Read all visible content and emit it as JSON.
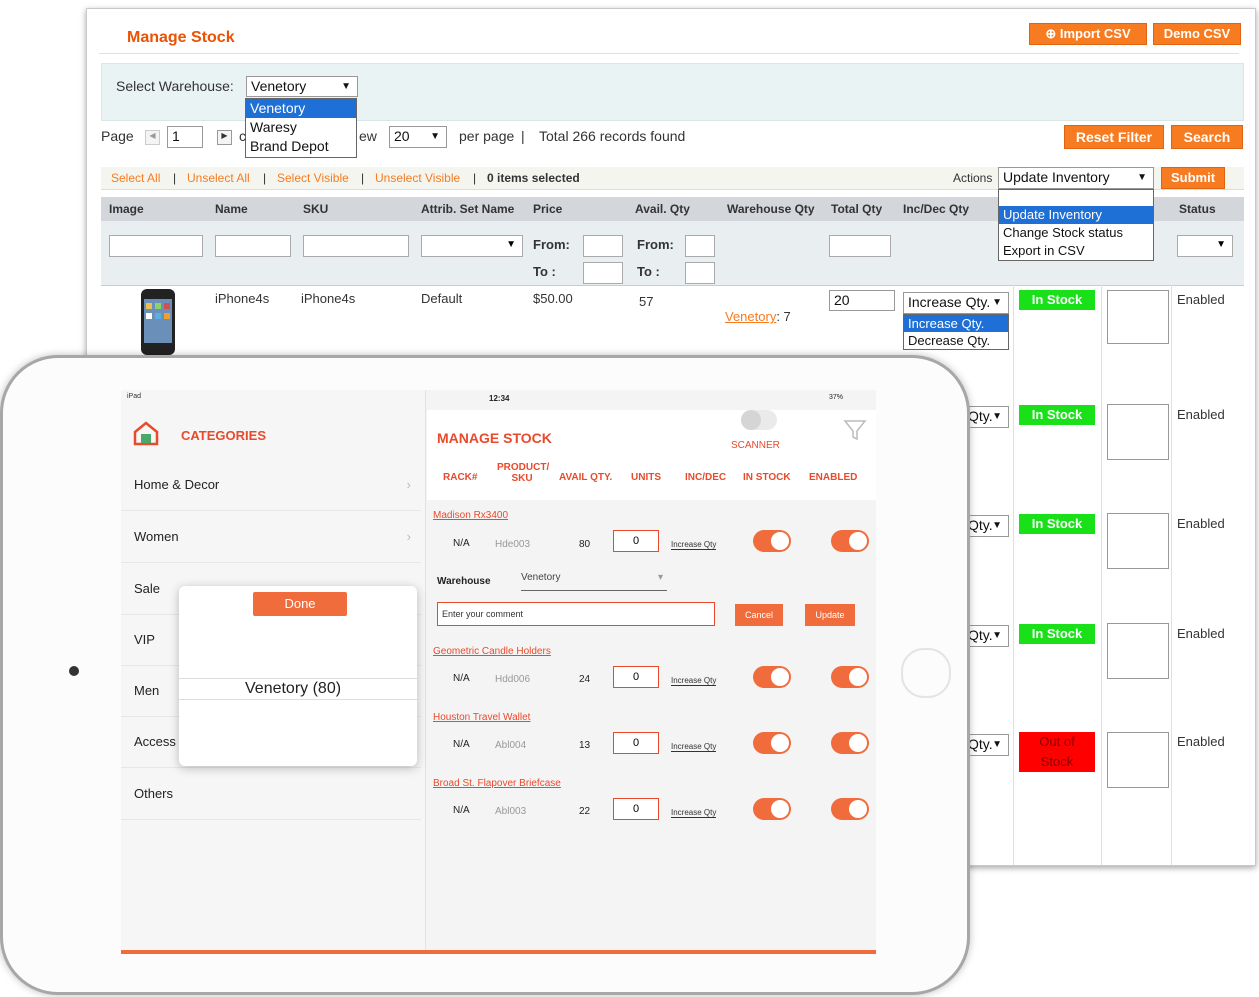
{
  "admin": {
    "title": "Manage Stock",
    "import_csv": "Import CSV",
    "demo_csv": "Demo CSV",
    "warehouse_label": "Select Warehouse:",
    "warehouse_value": "Venetory",
    "warehouse_options": [
      "Venetory",
      "Waresy",
      "Brand Depot"
    ],
    "page_label": "Page",
    "page_value": "1",
    "view_label_fragment": "ew",
    "per_page_value": "20",
    "per_page_label": "per page",
    "records_text": "Total 266 records found",
    "reset_filter": "Reset Filter",
    "search": "Search",
    "select_all": "Select All",
    "unselect_all": "Unselect All",
    "select_visible": "Select Visible",
    "unselect_visible": "Unselect Visible",
    "items_selected": "0 items selected",
    "actions_label": "Actions",
    "actions_value": "Update Inventory",
    "actions_options": [
      "Update Inventory",
      "Change Stock status",
      "Export in CSV"
    ],
    "submit": "Submit",
    "columns": [
      "Image",
      "Name",
      "SKU",
      "Attrib. Set Name",
      "Price",
      "Avail. Qty",
      "Warehouse Qty",
      "Total Qty",
      "Inc/Dec Qty",
      "Status"
    ],
    "from_label": "From:",
    "to_label": "To :",
    "row": {
      "name": "iPhone4s",
      "sku": "iPhone4s",
      "attrib": "Default",
      "price": "$50.00",
      "avail": "57",
      "warehouse_link": "Venetory",
      "warehouse_qty": ": 7",
      "total_qty": "20",
      "incdec_value": "Increase Qty.",
      "incdec_options": [
        "Increase Qty.",
        "Decrease Qty."
      ],
      "stock": "In Stock",
      "status": "Enabled"
    },
    "more_rows": [
      {
        "qty_sel": "Qty.",
        "stock": "In Stock",
        "status": "Enabled"
      },
      {
        "qty_sel": "Qty.",
        "stock": "In Stock",
        "status": "Enabled"
      },
      {
        "qty_sel": "Qty.",
        "stock": "In Stock",
        "status": "Enabled"
      },
      {
        "qty_sel": "Qty.",
        "stock_line1": "Out of",
        "stock_line2": "Stock",
        "status": "Enabled"
      }
    ]
  },
  "ipad": {
    "status_left": "iPad",
    "time": "12:34",
    "battery": "37%",
    "categories_title": "CATEGORIES",
    "categories": [
      "Home & Decor",
      "Women",
      "Sale",
      "VIP",
      "Men",
      "Access",
      "Others"
    ],
    "picker": {
      "done": "Done",
      "value": "Venetory  (80)"
    },
    "manage_title": "MANAGE STOCK",
    "scanner": "SCANNER",
    "headers": {
      "rack": "RACK#",
      "product": "PRODUCT/ SKU",
      "avail": "AVAIL QTY.",
      "units": "UNITS",
      "incdec": "INC/DEC",
      "instock": "IN STOCK",
      "enabled": "ENABLED"
    },
    "products": [
      {
        "name": "Madison Rx3400",
        "rack": "N/A",
        "sku": "Hde003",
        "avail": "80",
        "qty": "0",
        "incdec": "Increase Qty"
      },
      {
        "name": "Geometric Candle Holders",
        "rack": "N/A",
        "sku": "Hdd006",
        "avail": "24",
        "qty": "0",
        "incdec": "Increase Qty"
      },
      {
        "name": "Houston Travel Wallet",
        "rack": "N/A",
        "sku": "Abl004",
        "avail": "13",
        "qty": "0",
        "incdec": "Increase Qty"
      },
      {
        "name": "Broad St. Flapover Briefcase",
        "rack": "N/A",
        "sku": "Abl003",
        "avail": "22",
        "qty": "0",
        "incdec": "Increase Qty"
      }
    ],
    "warehouse_label": "Warehouse",
    "warehouse_value": "Venetory",
    "comment_placeholder": "Enter your comment",
    "cancel": "Cancel",
    "update": "Update"
  },
  "colors": {
    "accent": "#f77b20",
    "ipad_accent": "#e84a2c",
    "in_stock": "#19e019",
    "out_stock": "#ff0000"
  }
}
